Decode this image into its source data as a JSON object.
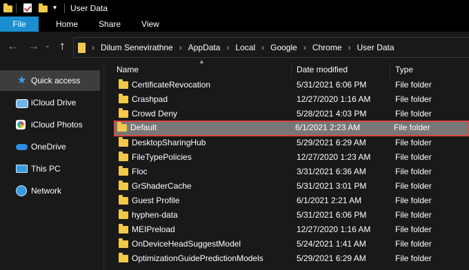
{
  "titlebar": {
    "title": "User Data"
  },
  "ribbon": {
    "tabs": [
      {
        "label": "File"
      },
      {
        "label": "Home"
      },
      {
        "label": "Share"
      },
      {
        "label": "View"
      }
    ]
  },
  "address": {
    "crumbs": [
      "Dilum Senevirathne",
      "AppData",
      "Local",
      "Google",
      "Chrome",
      "User Data"
    ]
  },
  "nav": {
    "items": [
      {
        "label": "Quick access",
        "icon": "star-icon"
      },
      {
        "label": "iCloud Drive",
        "icon": "cloud-icon"
      },
      {
        "label": "iCloud Photos",
        "icon": "photos-icon"
      },
      {
        "label": "OneDrive",
        "icon": "onedrive-icon"
      },
      {
        "label": "This PC",
        "icon": "computer-icon"
      },
      {
        "label": "Network",
        "icon": "network-icon"
      }
    ]
  },
  "columns": {
    "name": "Name",
    "date": "Date modified",
    "type": "Type"
  },
  "files": [
    {
      "name": "CertificateRevocation",
      "date": "5/31/2021 6:06 PM",
      "type": "File folder"
    },
    {
      "name": "Crashpad",
      "date": "12/27/2020 1:16 AM",
      "type": "File folder"
    },
    {
      "name": "Crowd Deny",
      "date": "5/28/2021 4:03 PM",
      "type": "File folder"
    },
    {
      "name": "Default",
      "date": "6/1/2021 2:23 AM",
      "type": "File folder"
    },
    {
      "name": "DesktopSharingHub",
      "date": "5/29/2021 6:29 AM",
      "type": "File folder"
    },
    {
      "name": "FileTypePolicies",
      "date": "12/27/2020 1:23 AM",
      "type": "File folder"
    },
    {
      "name": "Floc",
      "date": "3/31/2021 6:36 AM",
      "type": "File folder"
    },
    {
      "name": "GrShaderCache",
      "date": "5/31/2021 3:01 PM",
      "type": "File folder"
    },
    {
      "name": "Guest Profile",
      "date": "6/1/2021 2:21 AM",
      "type": "File folder"
    },
    {
      "name": "hyphen-data",
      "date": "5/31/2021 6:06 PM",
      "type": "File folder"
    },
    {
      "name": "MEIPreload",
      "date": "12/27/2020 1:16 AM",
      "type": "File folder"
    },
    {
      "name": "OnDeviceHeadSuggestModel",
      "date": "5/24/2021 1:41 AM",
      "type": "File folder"
    },
    {
      "name": "OptimizationGuidePredictionModels",
      "date": "5/29/2021 6:29 AM",
      "type": "File folder"
    }
  ],
  "colors": {
    "accent": "#1a8ed1",
    "folder": "#f2c94c",
    "selection_border": "#e0433c",
    "selection_fill": "#777777"
  }
}
